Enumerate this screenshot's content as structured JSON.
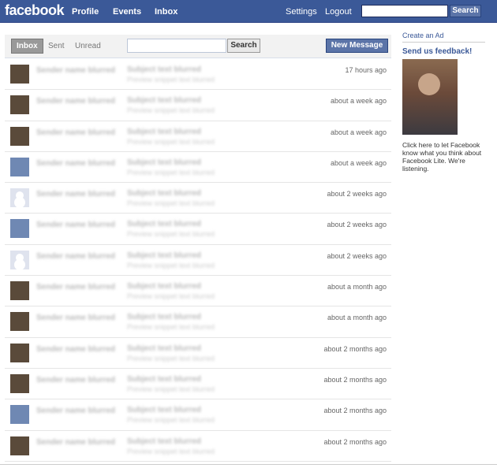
{
  "header": {
    "logo": "facebook",
    "nav": [
      "Profile",
      "Events",
      "Inbox"
    ],
    "settings": "Settings",
    "logout": "Logout",
    "search_placeholder": "",
    "search_button": "Search"
  },
  "toolbar": {
    "tabs": [
      "Inbox",
      "Sent",
      "Unread"
    ],
    "search_placeholder": "",
    "search_button": "Search",
    "new_message": "New Message"
  },
  "messages": [
    {
      "sender": "Sender name blurred",
      "subject": "Subject text blurred",
      "snippet": "Preview snippet text blurred",
      "time": "17 hours ago",
      "avatar": "photo"
    },
    {
      "sender": "Sender name blurred",
      "subject": "Subject text blurred",
      "snippet": "Preview snippet text blurred",
      "time": "about a week ago",
      "avatar": "photo"
    },
    {
      "sender": "Sender name blurred",
      "subject": "Subject text blurred",
      "snippet": "Preview snippet text blurred",
      "time": "about a week ago",
      "avatar": "photo"
    },
    {
      "sender": "Sender name blurred",
      "subject": "Subject text blurred",
      "snippet": "Preview snippet text blurred",
      "time": "about a week ago",
      "avatar": "blue"
    },
    {
      "sender": "Sender name blurred",
      "subject": "Subject text blurred",
      "snippet": "Preview snippet text blurred",
      "time": "about 2 weeks ago",
      "avatar": "blank"
    },
    {
      "sender": "Sender name blurred",
      "subject": "Subject text blurred",
      "snippet": "Preview snippet text blurred",
      "time": "about 2 weeks ago",
      "avatar": "blue"
    },
    {
      "sender": "Sender name blurred",
      "subject": "Subject text blurred",
      "snippet": "Preview snippet text blurred",
      "time": "about 2 weeks ago",
      "avatar": "blank"
    },
    {
      "sender": "Sender name blurred",
      "subject": "Subject text blurred",
      "snippet": "Preview snippet text blurred",
      "time": "about a month ago",
      "avatar": "photo"
    },
    {
      "sender": "Sender name blurred",
      "subject": "Subject text blurred",
      "snippet": "Preview snippet text blurred",
      "time": "about a month ago",
      "avatar": "photo"
    },
    {
      "sender": "Sender name blurred",
      "subject": "Subject text blurred",
      "snippet": "Preview snippet text blurred",
      "time": "about 2 months ago",
      "avatar": "photo"
    },
    {
      "sender": "Sender name blurred",
      "subject": "Subject text blurred",
      "snippet": "Preview snippet text blurred",
      "time": "about 2 months ago",
      "avatar": "photo"
    },
    {
      "sender": "Sender name blurred",
      "subject": "Subject text blurred",
      "snippet": "Preview snippet text blurred",
      "time": "about 2 months ago",
      "avatar": "blue"
    },
    {
      "sender": "Sender name blurred",
      "subject": "Subject text blurred",
      "snippet": "Preview snippet text blurred",
      "time": "about 2 months ago",
      "avatar": "photo"
    }
  ],
  "sidebar": {
    "create_ad": "Create an Ad",
    "feedback_title": "Send us feedback!",
    "feedback_text": "Click here to let Facebook know what you think about Facebook Lite. We're listening."
  },
  "colors": {
    "brand": "#3b5998",
    "button": "#5b74a8"
  }
}
